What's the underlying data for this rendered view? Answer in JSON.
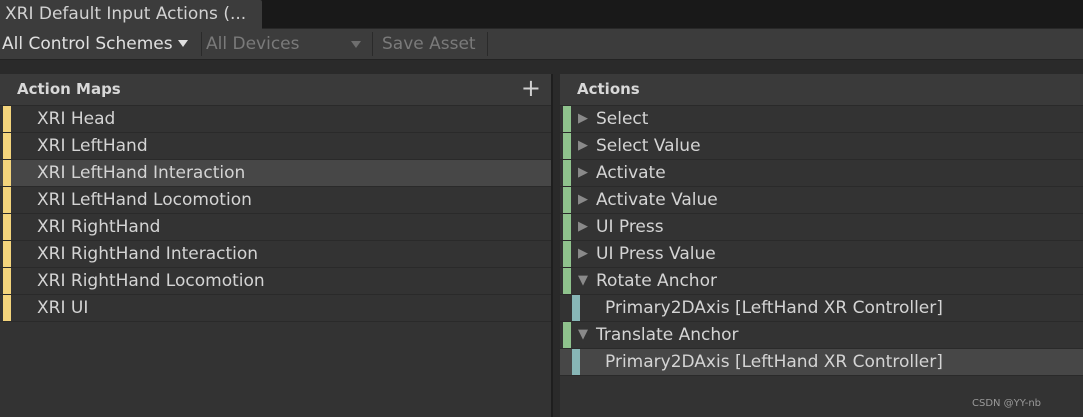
{
  "tab": {
    "title": "XRI Default Input Actions (..."
  },
  "toolbar": {
    "control_scheme": "All Control Schemes",
    "devices": "All Devices",
    "save_asset": "Save Asset"
  },
  "action_maps": {
    "header": "Action Maps",
    "add_glyph": "+",
    "items": [
      {
        "label": "XRI Head"
      },
      {
        "label": "XRI LeftHand"
      },
      {
        "label": "XRI LeftHand Interaction"
      },
      {
        "label": "XRI LeftHand Locomotion"
      },
      {
        "label": "XRI RightHand"
      },
      {
        "label": "XRI RightHand Interaction"
      },
      {
        "label": "XRI RightHand Locomotion"
      },
      {
        "label": "XRI UI"
      }
    ],
    "selected_index": 2
  },
  "actions": {
    "header": "Actions",
    "items": [
      {
        "label": "Select",
        "expanded": false
      },
      {
        "label": "Select Value",
        "expanded": false
      },
      {
        "label": "Activate",
        "expanded": false
      },
      {
        "label": "Activate Value",
        "expanded": false
      },
      {
        "label": "UI Press",
        "expanded": false
      },
      {
        "label": "UI Press Value",
        "expanded": false
      },
      {
        "label": "Rotate Anchor",
        "expanded": true
      },
      {
        "label": "Primary2DAxis [LeftHand XR Controller]",
        "binding": true
      },
      {
        "label": "Translate Anchor",
        "expanded": true
      },
      {
        "label": "Primary2DAxis [LeftHand XR Controller]",
        "binding": true,
        "selected": true
      }
    ]
  },
  "colors": {
    "action_map_stripe": "#f3d47c",
    "action_stripe": "#8fc38d",
    "binding_stripe": "#87b6b6"
  },
  "watermark": "CSDN @YY-nb"
}
